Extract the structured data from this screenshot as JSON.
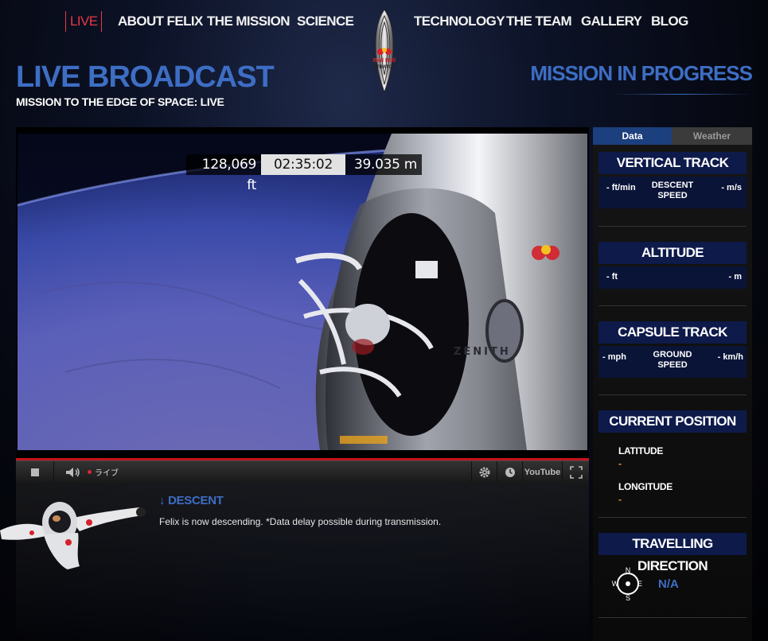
{
  "nav": {
    "live": "LIVE",
    "about": "ABOUT FELIX",
    "mission": "THE MISSION",
    "science": "SCIENCE",
    "technology": "TECHNOLOGY",
    "team": "THE TEAM",
    "gallery": "GALLERY",
    "blog": "BLOG"
  },
  "logo": {
    "icon": "red-bull-stratos-logo",
    "text_1": "Red Bull",
    "text_2": "STRATOS"
  },
  "header": {
    "title": "LIVE BROADCAST",
    "subtitle": "MISSION TO THE EDGE OF SPACE: LIVE",
    "status": "MISSION IN PROGRESS"
  },
  "video": {
    "telemetry": {
      "altitude_ft": "128,069 ft",
      "time": "02:35:02",
      "altitude_m": "39.035 m"
    },
    "capsule_text": "ZENITH",
    "controls": {
      "live_label": "ライブ",
      "youtube_label": "YouTube"
    },
    "progress": 1.0
  },
  "descent": {
    "heading": "↓ DESCENT",
    "text": "Felix is now descending. *Data delay possible during transmission."
  },
  "panel": {
    "tabs": {
      "data": "Data",
      "weather": "Weather"
    },
    "vertical_track": {
      "title": "VERTICAL TRACK",
      "left": "- ft/min",
      "center": "DESCENT SPEED",
      "right": "- m/s"
    },
    "altitude": {
      "title": "ALTITUDE",
      "left": "- ft",
      "right": "- m"
    },
    "capsule_track": {
      "title": "CAPSULE TRACK",
      "left": "- mph",
      "center": "GROUND SPEED",
      "right": "- km/h"
    },
    "current_position": {
      "title": "CURRENT POSITION",
      "latitude_label": "LATITUDE",
      "latitude_value": "-",
      "longitude_label": "LONGITUDE",
      "longitude_value": "-"
    },
    "travelling_direction": {
      "title": "TRAVELLING DIRECTION",
      "value": "N/A",
      "compass": {
        "n": "N",
        "e": "E",
        "s": "S",
        "w": "W"
      }
    }
  },
  "colors": {
    "accent_blue": "#3d6ec4",
    "live_red": "#e53a47",
    "panel_navy": "#0d1a4a",
    "value_orange": "#e99a1d"
  }
}
